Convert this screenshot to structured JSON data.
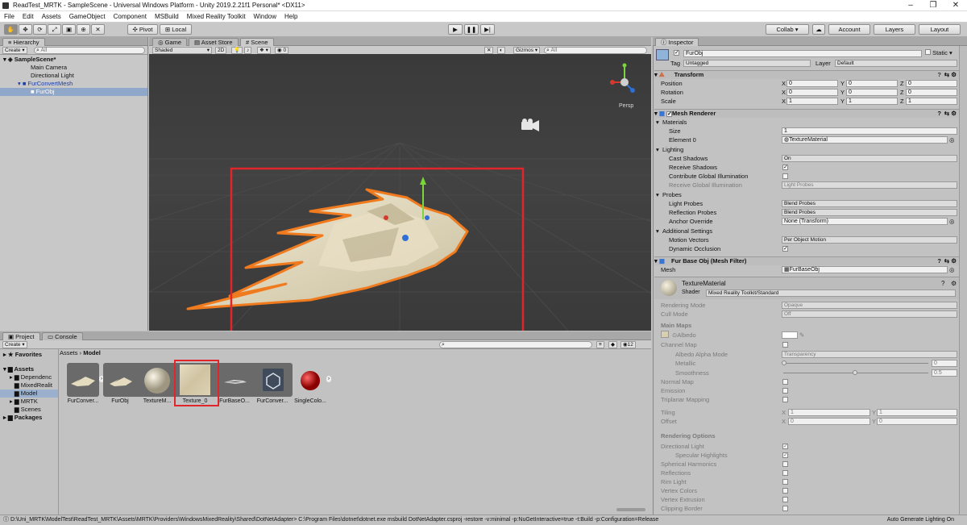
{
  "window": {
    "title": "ReadTest_MRTK - SampleScene - Universal Windows Platform - Unity 2019.2.21f1 Personal* <DX11>",
    "controls": [
      "–",
      "❐",
      "✕"
    ]
  },
  "menu": [
    "File",
    "Edit",
    "Assets",
    "GameObject",
    "Component",
    "MSBuild",
    "Mixed Reality Toolkit",
    "Window",
    "Help"
  ],
  "toolbar": {
    "pivot": "Pivot",
    "local": "Local",
    "collab": "Collab ▾",
    "account": "Account",
    "layers": "Layers",
    "layout": "Layout"
  },
  "hierarchy": {
    "tab": "Hierarchy",
    "create": "Create",
    "search_placeholder": "All",
    "items": [
      {
        "label": "SampleScene*"
      },
      {
        "label": "Main Camera"
      },
      {
        "label": "Directional Light"
      },
      {
        "label": "FurConvertMesh"
      },
      {
        "label": "FurObj"
      }
    ]
  },
  "views": {
    "game_tab": "Game",
    "asset_store_tab": "Asset Store",
    "scene_tab": "Scene",
    "shading": "Shaded",
    "mode2d": "2D",
    "fx_count": "0",
    "gizmos": "Gizmos",
    "search_placeholder": "All",
    "persp": "Persp"
  },
  "inspector": {
    "tab": "Inspector",
    "object_name": "FurObj",
    "static": "Static",
    "tag_label": "Tag",
    "tag_value": "Untagged",
    "layer_label": "Layer",
    "layer_value": "Default",
    "transform": {
      "title": "Transform",
      "rows": [
        {
          "label": "Position",
          "x": "0",
          "y": "0",
          "z": "0"
        },
        {
          "label": "Rotation",
          "x": "0",
          "y": "0",
          "z": "0"
        },
        {
          "label": "Scale",
          "x": "1",
          "y": "1",
          "z": "1"
        }
      ],
      "axis": [
        "X",
        "Y",
        "Z"
      ]
    },
    "mesh_renderer": {
      "title": "Mesh Renderer",
      "materials": "Materials",
      "size_label": "Size",
      "size_value": "1",
      "element0_label": "Element 0",
      "element0_value": "TextureMaterial",
      "lighting": "Lighting",
      "cast_shadows_label": "Cast Shadows",
      "cast_shadows_value": "On",
      "receive_shadows": "Receive Shadows",
      "contribute_gi": "Contribute Global Illumination",
      "receive_gi_label": "Receive Global Illumination",
      "receive_gi_value": "Light Probes",
      "probes": "Probes",
      "light_probes_label": "Light Probes",
      "light_probes_value": "Blend Probes",
      "reflection_probes_label": "Reflection Probes",
      "reflection_probes_value": "Blend Probes",
      "anchor_override_label": "Anchor Override",
      "anchor_override_value": "None (Transform)",
      "additional": "Additional Settings",
      "motion_vectors_label": "Motion Vectors",
      "motion_vectors_value": "Per Object Motion",
      "dynamic_occlusion": "Dynamic Occlusion"
    },
    "mesh_filter": {
      "title": "Fur Base Obj (Mesh Filter)",
      "mesh_label": "Mesh",
      "mesh_value": "FurBaseObj"
    },
    "material": {
      "name": "TextureMaterial",
      "shader_label": "Shader",
      "shader_value": "Mixed Reality Toolkit/Standard",
      "rendering_mode_label": "Rendering Mode",
      "rendering_mode_value": "Opaque",
      "cull_mode_label": "Cull Mode",
      "cull_mode_value": "Off",
      "main_maps": "Main Maps",
      "albedo": "Albedo",
      "channel_map": "Channel Map",
      "albedo_alpha_mode_label": "Albedo Alpha Mode",
      "albedo_alpha_mode_value": "Transparency",
      "metallic_label": "Metallic",
      "metallic_value": "0",
      "smoothness_label": "Smoothness",
      "smoothness_value": "0.5",
      "normal_map": "Normal Map",
      "emission": "Emission",
      "triplanar": "Triplanar Mapping",
      "tiling_label": "Tiling",
      "offset_label": "Offset",
      "tiling_x": "1",
      "tiling_y": "1",
      "offset_x": "0",
      "offset_y": "0",
      "xy": [
        "X",
        "Y"
      ],
      "rendering_options": "Rendering Options",
      "directional_light": "Directional Light",
      "specular_highlights": "Specular Highlights",
      "spherical_harmonics": "Spherical Harmonics",
      "reflections": "Reflections",
      "rim_light": "Rim Light",
      "vertex_colors": "Vertex Colors",
      "vertex_extrusion": "Vertex Extrusion",
      "clipping_border": "Clipping Border"
    }
  },
  "project": {
    "tab_project": "Project",
    "tab_console": "Console",
    "create": "Create",
    "favorites": "Favorites",
    "assets": "Assets",
    "tree": [
      "Dependenc",
      "MixedRealit",
      "Model",
      "MRTK",
      "Scenes"
    ],
    "packages": "Packages",
    "breadcrumb": [
      "Assets",
      "Model"
    ],
    "hidden_count": "12",
    "items": [
      {
        "label": "FurConver..."
      },
      {
        "label": "FurObj"
      },
      {
        "label": "TextureM..."
      },
      {
        "label": "Texture_0"
      },
      {
        "label": "FurBaseO..."
      },
      {
        "label": "FurConver..."
      },
      {
        "label": "SingleColo..."
      }
    ]
  },
  "status": {
    "message": "D:\\Uni_MRTK\\ModelTest\\ReadTest_MRTK\\Assets\\MRTK\\Providers\\WindowsMixedReality\\Shared\\DotNetAdapter> C:\\Program Files\\dotnet\\dotnet.exe msbuild DotNetAdapter.csproj -restore  -v:minimal -p:NuGetInteractive=true  -t:Build -p:Configuration=Release",
    "right": "Auto Generate Lighting On"
  },
  "colors": {
    "highlight": "#e0262b",
    "selection_outline": "#f07a1e",
    "scene_bg": "#3b3b3b",
    "panel_bg": "#c2c2c2"
  }
}
